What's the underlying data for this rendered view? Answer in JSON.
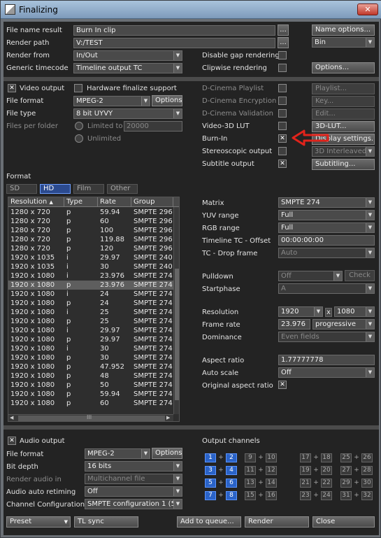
{
  "window": {
    "title": "Finalizing",
    "close_symbol": "✕"
  },
  "top": {
    "file_name_label": "File name result",
    "file_name_value": "Burn In clip",
    "render_path_label": "Render path",
    "render_path_value": "V:/TEST",
    "browse_label": "...",
    "name_options_label": "Name options...",
    "bin_value": "Bin",
    "render_from_label": "Render from",
    "render_from_value": "In/Out",
    "generic_tc_label": "Generic timecode",
    "generic_tc_value": "Timeline output TC",
    "disable_gap_label": "Disable gap rendering",
    "clipwise_label": "Clipwise rendering",
    "options_label": "Options..."
  },
  "video": {
    "video_output_label": "Video output",
    "video_output_checked": true,
    "hw_finalize_label": "Hardware finalize support",
    "hw_finalize_checked": false,
    "file_format_label": "File format",
    "file_format_value": "MPEG-2",
    "options_label": "Options",
    "file_type_label": "File type",
    "file_type_value": "8 bit UYVY",
    "files_per_folder_label": "Files per folder",
    "limited_to_label": "Limited to",
    "limited_to_value": "20000",
    "unlimited_label": "Unlimited"
  },
  "right_options": {
    "dcinema_playlist": {
      "label": "D-Cinema Playlist",
      "checked": false,
      "button": "Playlist..."
    },
    "dcinema_encryption": {
      "label": "D-Cinema Encryption",
      "checked": false,
      "button": "Key..."
    },
    "dcinema_validation": {
      "label": "D-Cinema Validation",
      "checked": false,
      "button": "Edit..."
    },
    "video3d_lut": {
      "label": "Video-3D LUT",
      "checked": false,
      "button": "3D-LUT..."
    },
    "burn_in": {
      "label": "Burn-In",
      "checked": true,
      "button": "Display settings..."
    },
    "stereoscopic": {
      "label": "Stereoscopic output",
      "checked": false,
      "value": "3D Interleaved s"
    },
    "subtitle": {
      "label": "Subtitle output",
      "checked": true,
      "button": "Subtitling..."
    }
  },
  "format": {
    "label": "Format",
    "tabs": [
      "SD",
      "HD",
      "Film",
      "Other"
    ],
    "selected_tab": "HD",
    "columns": [
      "Resolution",
      "Type",
      "Rate",
      "Group"
    ],
    "rows": [
      [
        "1280 x 720",
        "p",
        "59.94",
        "SMPTE 296"
      ],
      [
        "1280 x 720",
        "p",
        "60",
        "SMPTE 296"
      ],
      [
        "1280 x 720",
        "p",
        "100",
        "SMPTE 296"
      ],
      [
        "1280 x 720",
        "p",
        "119.88",
        "SMPTE 296"
      ],
      [
        "1280 x 720",
        "p",
        "120",
        "SMPTE 296"
      ],
      [
        "1920 x 1035",
        "i",
        "29.97",
        "SMPTE 240"
      ],
      [
        "1920 x 1035",
        "i",
        "30",
        "SMPTE 240"
      ],
      [
        "1920 x 1080",
        "i",
        "23.976",
        "SMPTE 274"
      ],
      [
        "1920 x 1080",
        "p",
        "23.976",
        "SMPTE 274"
      ],
      [
        "1920 x 1080",
        "i",
        "24",
        "SMPTE 274"
      ],
      [
        "1920 x 1080",
        "p",
        "24",
        "SMPTE 274"
      ],
      [
        "1920 x 1080",
        "i",
        "25",
        "SMPTE 274"
      ],
      [
        "1920 x 1080",
        "p",
        "25",
        "SMPTE 274"
      ],
      [
        "1920 x 1080",
        "i",
        "29.97",
        "SMPTE 274"
      ],
      [
        "1920 x 1080",
        "p",
        "29.97",
        "SMPTE 274"
      ],
      [
        "1920 x 1080",
        "i",
        "30",
        "SMPTE 274"
      ],
      [
        "1920 x 1080",
        "p",
        "30",
        "SMPTE 274"
      ],
      [
        "1920 x 1080",
        "p",
        "47.952",
        "SMPTE 274"
      ],
      [
        "1920 x 1080",
        "p",
        "48",
        "SMPTE 274"
      ],
      [
        "1920 x 1080",
        "p",
        "50",
        "SMPTE 274"
      ],
      [
        "1920 x 1080",
        "p",
        "59.94",
        "SMPTE 274"
      ],
      [
        "1920 x 1080",
        "p",
        "60",
        "SMPTE 274"
      ]
    ],
    "selected_row": 8,
    "scroll_mark": "III"
  },
  "params": {
    "matrix_label": "Matrix",
    "matrix_value": "SMPTE 274",
    "yuv_label": "YUV range",
    "yuv_value": "Full",
    "rgb_label": "RGB range",
    "rgb_value": "Full",
    "tc_offset_label": "Timeline TC - Offset",
    "tc_offset_value": "00:00:00:00",
    "tc_drop_label": "TC - Drop frame",
    "tc_drop_value": "Auto",
    "pulldown_label": "Pulldown",
    "pulldown_value": "Off",
    "check_label": "Check",
    "startphase_label": "Startphase",
    "startphase_value": "A",
    "resolution_label": "Resolution",
    "res_w": "1920",
    "res_x": "x",
    "res_h": "1080",
    "frame_rate_label": "Frame rate",
    "frame_rate_value": "23.976",
    "scan_value": "progressive",
    "dominance_label": "Dominance",
    "dominance_value": "Even fields",
    "aspect_label": "Aspect ratio",
    "aspect_value": "1.77777778",
    "auto_scale_label": "Auto scale",
    "auto_scale_value": "Off",
    "orig_aspect_label": "Original aspect ratio",
    "orig_aspect_checked": true
  },
  "audio": {
    "audio_output_label": "Audio output",
    "audio_output_checked": true,
    "file_format_label": "File format",
    "file_format_value": "MPEG-2",
    "options_label": "Options",
    "bit_depth_label": "Bit depth",
    "bit_depth_value": "16 bits",
    "render_in_label": "Render audio in",
    "render_in_value": "Multichannel file",
    "retiming_label": "Audio auto retiming",
    "retiming_value": "Off",
    "channel_config_label": "Channel Configuration",
    "channel_config_value": "SMPTE configuration 1 (5.",
    "output_channels_label": "Output channels",
    "channel_groups": [
      [
        [
          "1",
          "2"
        ],
        [
          "3",
          "4"
        ],
        [
          "5",
          "6"
        ],
        [
          "7",
          "8"
        ]
      ],
      [
        [
          "9",
          "10"
        ],
        [
          "11",
          "12"
        ],
        [
          "13",
          "14"
        ],
        [
          "15",
          "16"
        ]
      ],
      [
        [
          "17",
          "18"
        ],
        [
          "19",
          "20"
        ],
        [
          "21",
          "22"
        ],
        [
          "23",
          "24"
        ]
      ],
      [
        [
          "25",
          "26"
        ],
        [
          "27",
          "28"
        ],
        [
          "29",
          "30"
        ],
        [
          "31",
          "32"
        ]
      ]
    ],
    "plus": "+"
  },
  "bottom": {
    "preset_label": "Preset",
    "tl_sync_label": "TL sync",
    "add_queue_label": "Add to queue...",
    "render_label": "Render",
    "close_label": "Close"
  },
  "colors": {
    "selected_tab": "#2b4a8f",
    "active_channel": "#2a63c8",
    "arrow": "#e0231b"
  }
}
